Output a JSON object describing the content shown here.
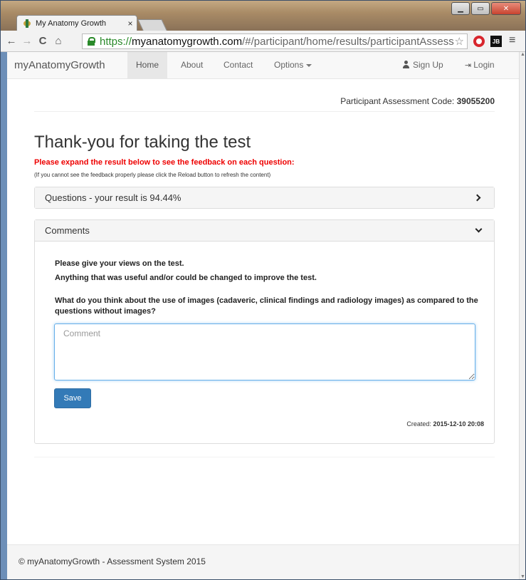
{
  "browser": {
    "tab_title": "My Anatomy Growth",
    "tab_close": "×",
    "url_protocol": "https://",
    "url_host": "myanatomygrowth.com",
    "url_path": "/#/participant/home/results/participantAssess",
    "ext_label": "JB"
  },
  "navbar": {
    "brand": "myAnatomyGrowth",
    "links": [
      "Home",
      "About",
      "Contact",
      "Options"
    ],
    "sign_up": "Sign Up",
    "login": "Login"
  },
  "assessment": {
    "code_label": "Participant Assessment Code:",
    "code_value": "39055200"
  },
  "page": {
    "title": "Thank-you for taking the test",
    "warning": "Please expand the result below to see the feedback on each question:",
    "note": "(If you cannot see the feedback properly please click the Reload button to refresh the content)"
  },
  "results_panel": {
    "heading": "Questions - your result is 94.44%"
  },
  "comments_panel": {
    "heading": "Comments",
    "line1": "Please give your views on the test.",
    "line2": "Anything that was useful and/or could be changed to improve the test.",
    "line3": "What do you think about the use of images (cadaveric, clinical findings and radiology images) as compared to the questions without images?",
    "placeholder": "Comment",
    "save_label": "Save",
    "created_label": "Created:",
    "created_value": "2015-12-10 20:08"
  },
  "footer": {
    "text": "© myAnatomyGrowth - Assessment System 2015"
  }
}
